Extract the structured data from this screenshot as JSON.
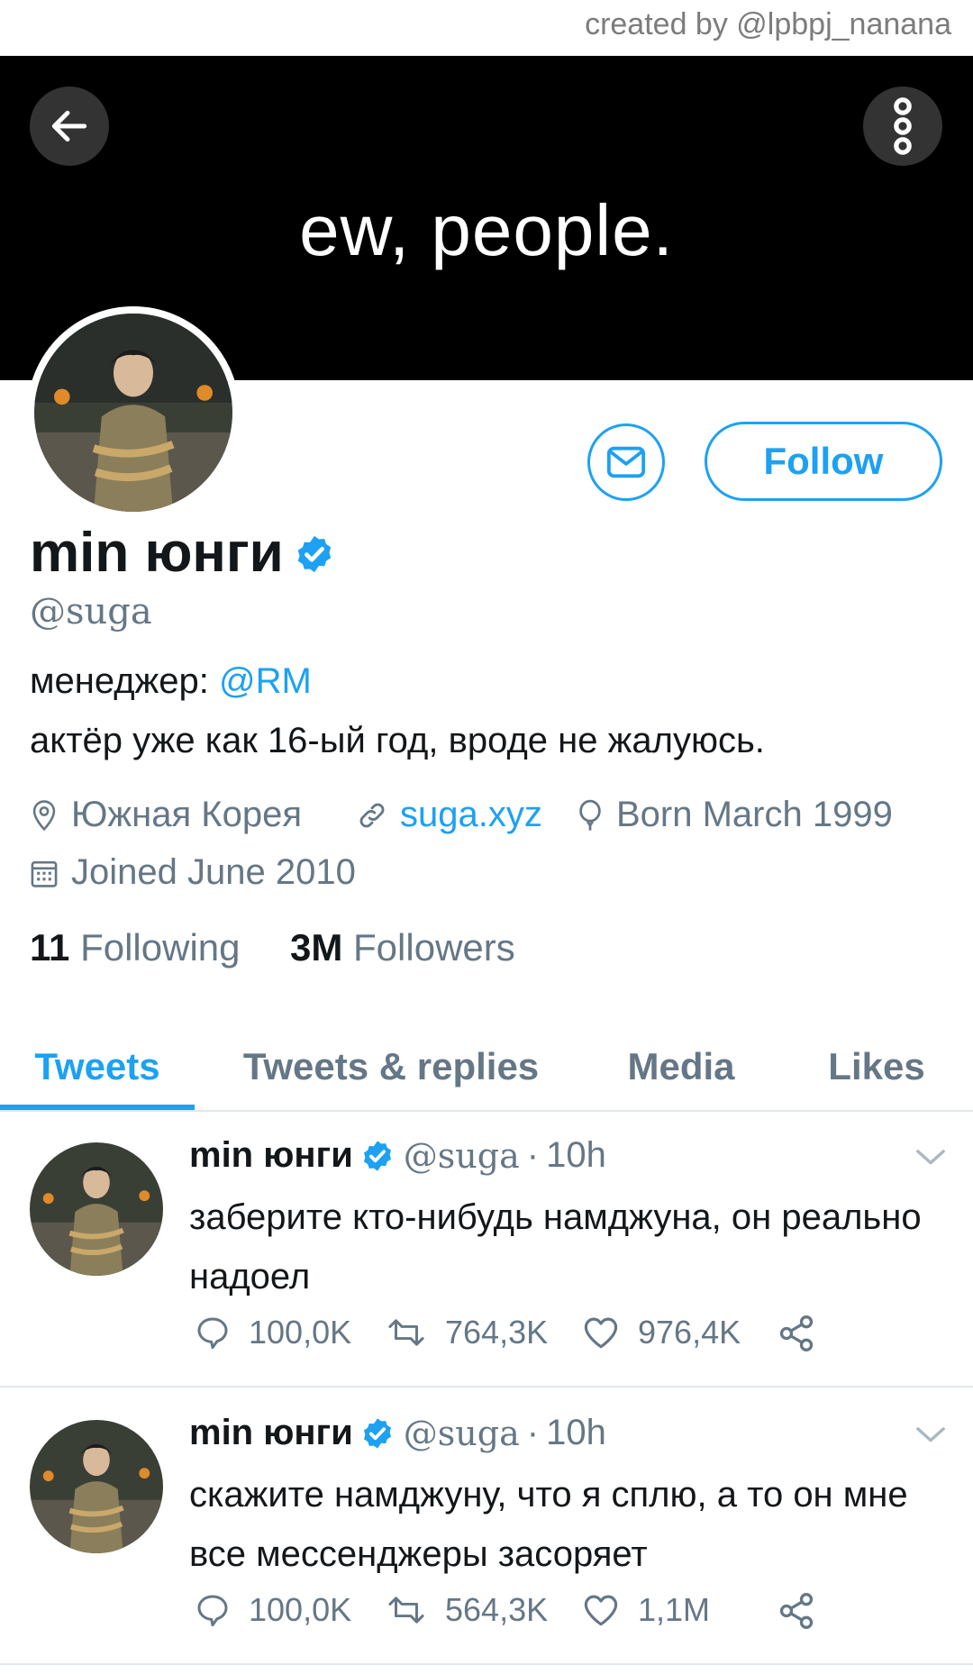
{
  "credit": "created by @lpbpj_nanana",
  "banner": {
    "text": "ew, people."
  },
  "profile": {
    "name": "min юнги",
    "handle": "@suga",
    "bio_prefix": "менеджер:",
    "bio_mention": "@RM",
    "bio_line2": "актёр уже как 16-ый год, вроде не жалуюсь.",
    "location": "Южная Корея",
    "website": "suga.xyz",
    "born": "Born March 1999",
    "joined": "Joined June 2010",
    "following_count": "11",
    "following_label": "Following",
    "followers_count": "3M",
    "followers_label": "Followers"
  },
  "buttons": {
    "follow": "Follow"
  },
  "tabs": [
    {
      "label": "Tweets",
      "active": true
    },
    {
      "label": "Tweets & replies",
      "active": false
    },
    {
      "label": "Media",
      "active": false
    },
    {
      "label": "Likes",
      "active": false
    }
  ],
  "tweets": [
    {
      "name": "min юнги",
      "handle": "@suga",
      "sep": "·",
      "time": "10h",
      "text": "заберите кто-нибудь намджуна, он реально надоел",
      "replies": "100,0K",
      "retweets": "764,3K",
      "likes": "976,4K"
    },
    {
      "name": "min юнги",
      "handle": "@suga",
      "sep": "·",
      "time": "10h",
      "text": "скажите намджуну, что я сплю, а то он мне все мессенджеры засоряет",
      "replies": "100,0K",
      "retweets": "564,3K",
      "likes": "1,1M"
    }
  ],
  "colors": {
    "accent": "#1da1f2",
    "secondary_text": "#657786",
    "banner": "#000000"
  }
}
